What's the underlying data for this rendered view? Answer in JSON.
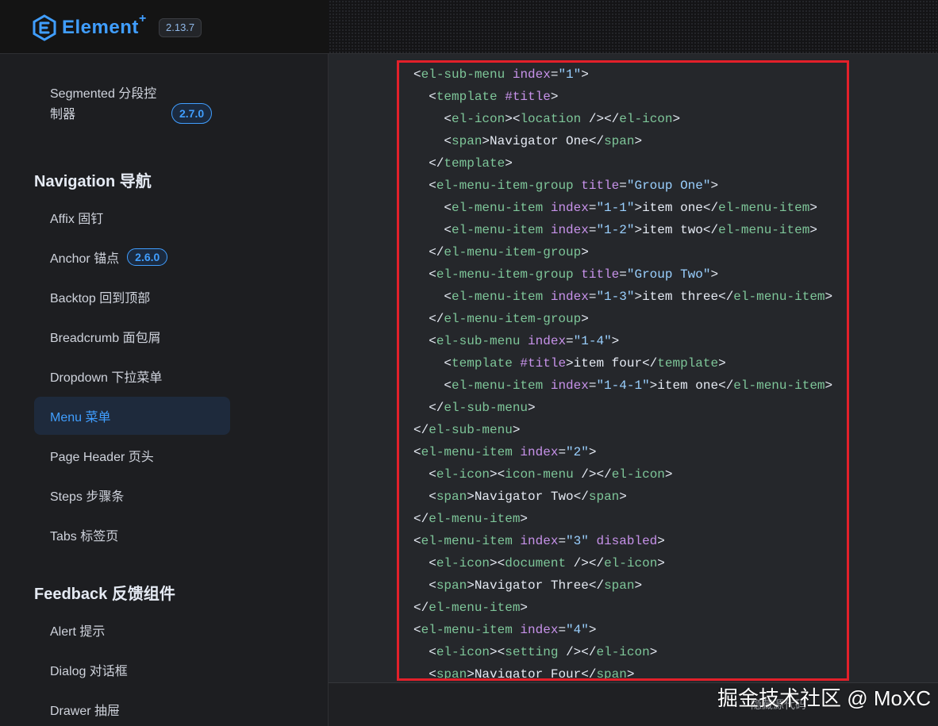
{
  "header": {
    "logo_text": "Element",
    "logo_plus": "+",
    "version": "2.13.7"
  },
  "sidebar": {
    "segmented": {
      "label": "Segmented 分段控制器",
      "badge": "2.7.0"
    },
    "groups": [
      {
        "title": "Navigation 导航"
      },
      {
        "title": "Feedback 反馈组件"
      }
    ],
    "items": [
      {
        "label": "Affix 固钉"
      },
      {
        "label": "Anchor 锚点",
        "badge": "2.6.0"
      },
      {
        "label": "Backtop 回到顶部"
      },
      {
        "label": "Breadcrumb 面包屑"
      },
      {
        "label": "Dropdown 下拉菜单"
      },
      {
        "label": "Menu 菜单",
        "active": true
      },
      {
        "label": "Page Header 页头"
      },
      {
        "label": "Steps 步骤条"
      },
      {
        "label": "Tabs 标签页"
      },
      {
        "label": "Alert 提示"
      },
      {
        "label": "Dialog 对话框"
      },
      {
        "label": "Drawer 抽屉"
      }
    ]
  },
  "code": {
    "lines": [
      "<el-sub-menu index=\"1\">",
      "  <template #title>",
      "    <el-icon><location /></el-icon>",
      "    <span>Navigator One</span>",
      "  </template>",
      "  <el-menu-item-group title=\"Group One\">",
      "    <el-menu-item index=\"1-1\">item one</el-menu-item>",
      "    <el-menu-item index=\"1-2\">item two</el-menu-item>",
      "  </el-menu-item-group>",
      "  <el-menu-item-group title=\"Group Two\">",
      "    <el-menu-item index=\"1-3\">item three</el-menu-item>",
      "  </el-menu-item-group>",
      "  <el-sub-menu index=\"1-4\">",
      "    <template #title>item four</template>",
      "    <el-menu-item index=\"1-4-1\">item one</el-menu-item>",
      "  </el-sub-menu>",
      "</el-sub-menu>",
      "<el-menu-item index=\"2\">",
      "  <el-icon><icon-menu /></el-icon>",
      "  <span>Navigator Two</span>",
      "</el-menu-item>",
      "<el-menu-item index=\"3\" disabled>",
      "  <el-icon><document /></el-icon>",
      "  <span>Navigator Three</span>",
      "</el-menu-item>",
      "<el-menu-item index=\"4\">",
      "  <el-icon><setting /></el-icon>",
      "  <span>Navigator Four</span>"
    ]
  },
  "footer": {
    "hide_source": "隐藏源代码"
  },
  "watermark": "掘金技术社区 @ MoXC",
  "colors": {
    "accent": "#409eff",
    "highlight_border": "#e3202a"
  }
}
